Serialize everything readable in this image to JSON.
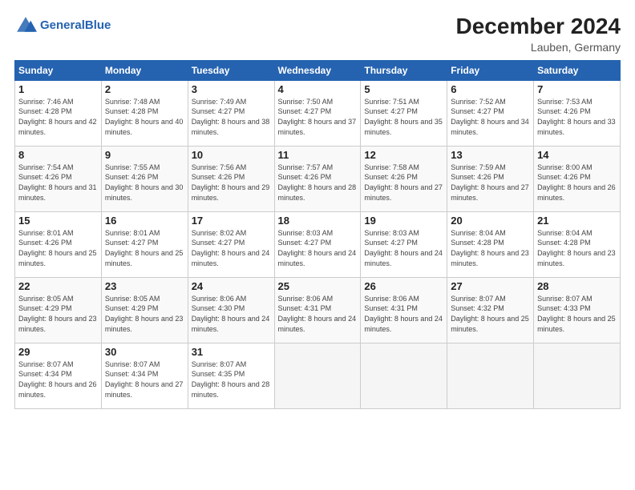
{
  "header": {
    "logo_general": "General",
    "logo_blue": "Blue",
    "month_title": "December 2024",
    "location": "Lauben, Germany"
  },
  "days_of_week": [
    "Sunday",
    "Monday",
    "Tuesday",
    "Wednesday",
    "Thursday",
    "Friday",
    "Saturday"
  ],
  "weeks": [
    [
      {
        "day": "1",
        "sunrise": "7:46 AM",
        "sunset": "4:28 PM",
        "daylight": "8 hours and 42 minutes."
      },
      {
        "day": "2",
        "sunrise": "7:48 AM",
        "sunset": "4:28 PM",
        "daylight": "8 hours and 40 minutes."
      },
      {
        "day": "3",
        "sunrise": "7:49 AM",
        "sunset": "4:27 PM",
        "daylight": "8 hours and 38 minutes."
      },
      {
        "day": "4",
        "sunrise": "7:50 AM",
        "sunset": "4:27 PM",
        "daylight": "8 hours and 37 minutes."
      },
      {
        "day": "5",
        "sunrise": "7:51 AM",
        "sunset": "4:27 PM",
        "daylight": "8 hours and 35 minutes."
      },
      {
        "day": "6",
        "sunrise": "7:52 AM",
        "sunset": "4:27 PM",
        "daylight": "8 hours and 34 minutes."
      },
      {
        "day": "7",
        "sunrise": "7:53 AM",
        "sunset": "4:26 PM",
        "daylight": "8 hours and 33 minutes."
      }
    ],
    [
      {
        "day": "8",
        "sunrise": "7:54 AM",
        "sunset": "4:26 PM",
        "daylight": "8 hours and 31 minutes."
      },
      {
        "day": "9",
        "sunrise": "7:55 AM",
        "sunset": "4:26 PM",
        "daylight": "8 hours and 30 minutes."
      },
      {
        "day": "10",
        "sunrise": "7:56 AM",
        "sunset": "4:26 PM",
        "daylight": "8 hours and 29 minutes."
      },
      {
        "day": "11",
        "sunrise": "7:57 AM",
        "sunset": "4:26 PM",
        "daylight": "8 hours and 28 minutes."
      },
      {
        "day": "12",
        "sunrise": "7:58 AM",
        "sunset": "4:26 PM",
        "daylight": "8 hours and 27 minutes."
      },
      {
        "day": "13",
        "sunrise": "7:59 AM",
        "sunset": "4:26 PM",
        "daylight": "8 hours and 27 minutes."
      },
      {
        "day": "14",
        "sunrise": "8:00 AM",
        "sunset": "4:26 PM",
        "daylight": "8 hours and 26 minutes."
      }
    ],
    [
      {
        "day": "15",
        "sunrise": "8:01 AM",
        "sunset": "4:26 PM",
        "daylight": "8 hours and 25 minutes."
      },
      {
        "day": "16",
        "sunrise": "8:01 AM",
        "sunset": "4:27 PM",
        "daylight": "8 hours and 25 minutes."
      },
      {
        "day": "17",
        "sunrise": "8:02 AM",
        "sunset": "4:27 PM",
        "daylight": "8 hours and 24 minutes."
      },
      {
        "day": "18",
        "sunrise": "8:03 AM",
        "sunset": "4:27 PM",
        "daylight": "8 hours and 24 minutes."
      },
      {
        "day": "19",
        "sunrise": "8:03 AM",
        "sunset": "4:27 PM",
        "daylight": "8 hours and 24 minutes."
      },
      {
        "day": "20",
        "sunrise": "8:04 AM",
        "sunset": "4:28 PM",
        "daylight": "8 hours and 23 minutes."
      },
      {
        "day": "21",
        "sunrise": "8:04 AM",
        "sunset": "4:28 PM",
        "daylight": "8 hours and 23 minutes."
      }
    ],
    [
      {
        "day": "22",
        "sunrise": "8:05 AM",
        "sunset": "4:29 PM",
        "daylight": "8 hours and 23 minutes."
      },
      {
        "day": "23",
        "sunrise": "8:05 AM",
        "sunset": "4:29 PM",
        "daylight": "8 hours and 23 minutes."
      },
      {
        "day": "24",
        "sunrise": "8:06 AM",
        "sunset": "4:30 PM",
        "daylight": "8 hours and 24 minutes."
      },
      {
        "day": "25",
        "sunrise": "8:06 AM",
        "sunset": "4:31 PM",
        "daylight": "8 hours and 24 minutes."
      },
      {
        "day": "26",
        "sunrise": "8:06 AM",
        "sunset": "4:31 PM",
        "daylight": "8 hours and 24 minutes."
      },
      {
        "day": "27",
        "sunrise": "8:07 AM",
        "sunset": "4:32 PM",
        "daylight": "8 hours and 25 minutes."
      },
      {
        "day": "28",
        "sunrise": "8:07 AM",
        "sunset": "4:33 PM",
        "daylight": "8 hours and 25 minutes."
      }
    ],
    [
      {
        "day": "29",
        "sunrise": "8:07 AM",
        "sunset": "4:34 PM",
        "daylight": "8 hours and 26 minutes."
      },
      {
        "day": "30",
        "sunrise": "8:07 AM",
        "sunset": "4:34 PM",
        "daylight": "8 hours and 27 minutes."
      },
      {
        "day": "31",
        "sunrise": "8:07 AM",
        "sunset": "4:35 PM",
        "daylight": "8 hours and 28 minutes."
      },
      null,
      null,
      null,
      null
    ]
  ],
  "labels": {
    "sunrise": "Sunrise:",
    "sunset": "Sunset:",
    "daylight": "Daylight:"
  }
}
